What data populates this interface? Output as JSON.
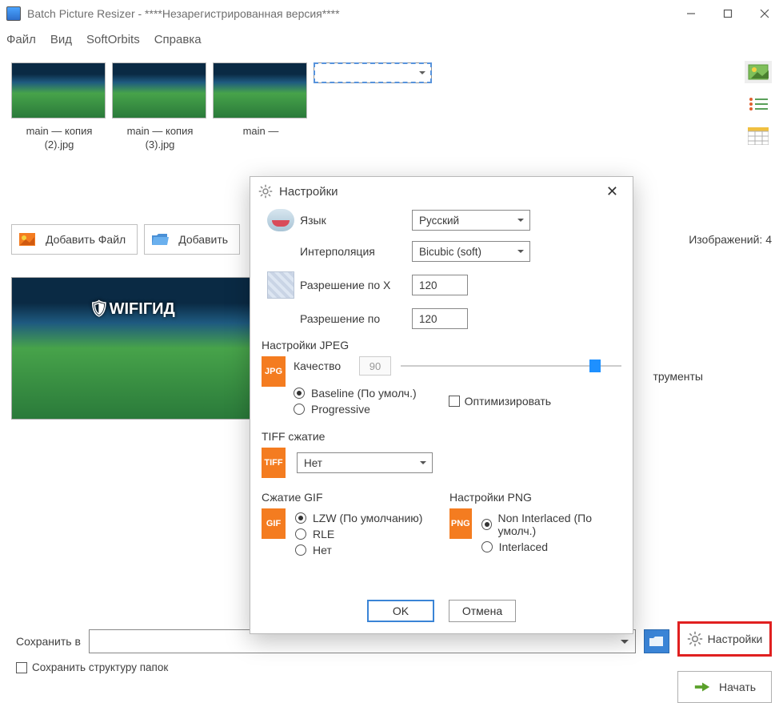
{
  "window": {
    "title": "Batch Picture Resizer - ****Незарегистрированная версия****"
  },
  "menu": [
    "Файл",
    "Вид",
    "SoftOrbits",
    "Справка"
  ],
  "thumbnails": [
    {
      "name": "main — копия (2).jpg"
    },
    {
      "name": "main — копия (3).jpg"
    },
    {
      "name": "main —"
    },
    {
      "name": ""
    }
  ],
  "toolbar": {
    "add_file": "Добавить Файл",
    "add_folder": "Добавить",
    "images_count_label": "Изображений: 4"
  },
  "peek_right": "трументы",
  "preview_logo": "🛡WIFIГИД",
  "bottom": {
    "save_in": "Сохранить в",
    "keep_structure": "Сохранить структуру папок",
    "settings": "Настройки",
    "start": "Начать"
  },
  "dialog": {
    "title": "Настройки",
    "language_label": "Язык",
    "language_value": "Русский",
    "interp_label": "Интерполяция",
    "interp_value": "Bicubic (soft)",
    "res_x_label": "Разрешение по X",
    "res_x_value": "120",
    "res_y_label": "Разрешение по",
    "res_y_value": "120",
    "jpeg_section": "Настройки JPEG",
    "quality_label": "Качество",
    "quality_value": "90",
    "baseline": "Baseline (По умолч.)",
    "progressive": "Progressive",
    "optimize": "Оптимизировать",
    "tiff_section": "TIFF сжатие",
    "tiff_value": "Нет",
    "gif_section": "Сжатие GIF",
    "gif_lzw": "LZW (По умолчанию)",
    "gif_rle": "RLE",
    "gif_none": "Нет",
    "png_section": "Настройки PNG",
    "png_noninter": "Non Interlaced (По умолч.)",
    "png_inter": "Interlaced",
    "ok": "OK",
    "cancel": "Отмена"
  }
}
